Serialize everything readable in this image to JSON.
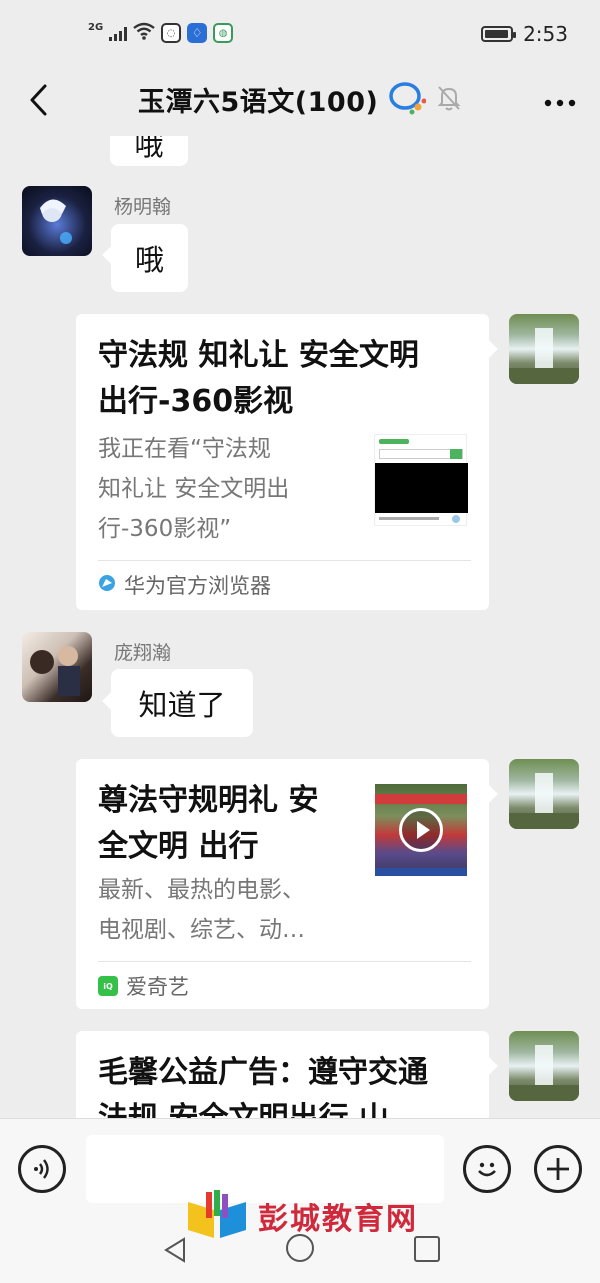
{
  "status_bar": {
    "network": "2G",
    "time": "2:53",
    "battery_level": 0.95
  },
  "header": {
    "back_icon": "chevron-left-icon",
    "title": "玉潭六5语文(100)",
    "more_icon": "more-dots-icon"
  },
  "messages": {
    "partial_top": {
      "text": "哦"
    },
    "msg1": {
      "sender": "杨明翰",
      "text": "哦"
    },
    "card1": {
      "title_line1": "守法规 知礼让 安全文明",
      "title_line2": "出行-360影视",
      "desc_line1": "我正在看“守法规",
      "desc_line2": "知礼让 安全文明出",
      "desc_line3": "行-360影视”",
      "source": "华为官方浏览器"
    },
    "msg2": {
      "sender": "庞翔瀚",
      "text": "知道了"
    },
    "card2": {
      "title_line1": "尊法守规明礼 安",
      "title_line2": "全文明 出行",
      "desc_line1": "最新、最热的电影、",
      "desc_line2": "电视剧、综艺、动…",
      "source": "爱奇艺"
    },
    "card3": {
      "title_line1": "毛馨公益广告：遵守交通",
      "title_line2": "法规 安全文明出行 山"
    }
  },
  "input_bar": {
    "voice_icon": "voice-icon",
    "emoji_icon": "emoji-icon",
    "plus_icon": "plus-icon"
  },
  "watermark": {
    "text": "彭城教育网"
  },
  "colors": {
    "background": "#ededed",
    "bubble": "#ffffff",
    "watermark_red": "#d0293b"
  }
}
